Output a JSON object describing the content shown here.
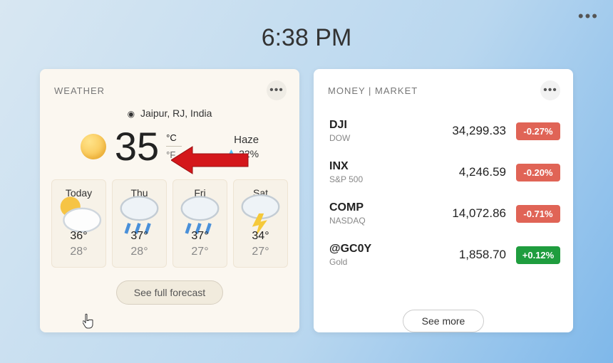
{
  "system": {
    "clock": "6:38 PM"
  },
  "weather": {
    "title": "WEATHER",
    "location": "Jaipur, RJ, India",
    "temp": "35",
    "unit_c": "°C",
    "unit_f": "°F",
    "condition": "Haze",
    "humidity": "22%",
    "cta": "See full forecast",
    "days": [
      {
        "label": "Today",
        "icon": "cloud-sun",
        "hi": "36°",
        "lo": "28°"
      },
      {
        "label": "Thu",
        "icon": "rain",
        "hi": "37°",
        "lo": "28°"
      },
      {
        "label": "Fri",
        "icon": "rain",
        "hi": "37°",
        "lo": "27°"
      },
      {
        "label": "Sat",
        "icon": "storm",
        "hi": "34°",
        "lo": "27°"
      }
    ]
  },
  "money": {
    "title": "MONEY | MARKET",
    "cta": "See more",
    "rows": [
      {
        "sym": "DJI",
        "name": "DOW",
        "price": "34,299.33",
        "chg": "-0.27%",
        "dir": "neg"
      },
      {
        "sym": "INX",
        "name": "S&P 500",
        "price": "4,246.59",
        "chg": "-0.20%",
        "dir": "neg"
      },
      {
        "sym": "COMP",
        "name": "NASDAQ",
        "price": "14,072.86",
        "chg": "-0.71%",
        "dir": "neg"
      },
      {
        "sym": "@GC0Y",
        "name": "Gold",
        "price": "1,858.70",
        "chg": "+0.12%",
        "dir": "pos"
      }
    ]
  }
}
